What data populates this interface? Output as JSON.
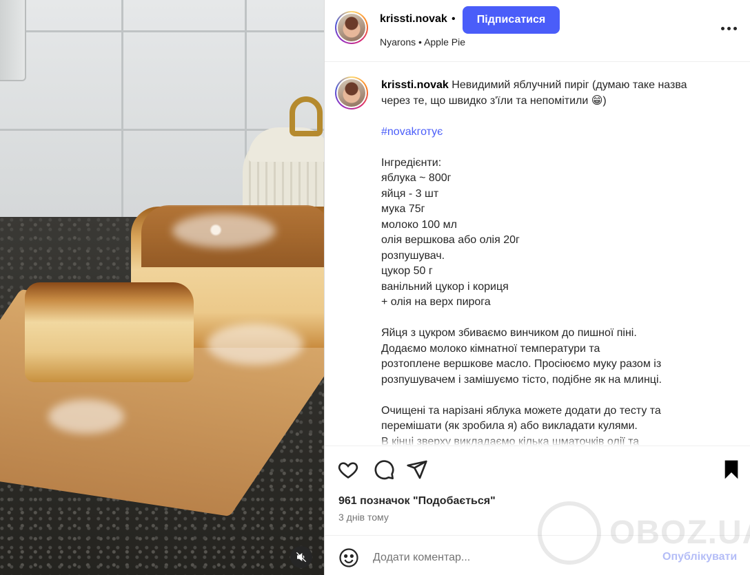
{
  "post": {
    "username": "krissti.novak",
    "separator_dot": "•",
    "follow_label": "Підписатися",
    "subtitle_artist": "Nyarons",
    "subtitle_dot": "•",
    "subtitle_track": "Apple Pie"
  },
  "caption": {
    "username": "krissti.novak",
    "lines": [
      "Невидимий яблучний пиріг (думаю таке назва",
      "через те, що швидко з'їли та непомітили 😁)",
      "",
      "#novakготує",
      "",
      "Інгредієнти:",
      "яблука ~ 800г",
      "яйця - 3 шт",
      "мука 75г",
      "молоко 100 мл",
      "олія вершкова або олія 20г",
      "розпушувач.",
      "цукор 50 г",
      "ванільний цукор і кориця",
      "+ олія на верх пирога",
      "",
      "Яйця з цукром збиваємо винчиком до пишної піні.",
      "Додаємо молоко кімнатної температури та",
      "розтоплене вершкове масло. Просіюємо муку разом із",
      "розпушувачем і замішуємо тісто, подібне як на млинці.",
      "",
      "Очищені та нарізані яблука можете додати до тесту та",
      "перемішати (як зробила я) або викладати кулями.",
      "В кінці зверху викладаємо кілька шматочків олії та"
    ]
  },
  "engagement": {
    "likes_text": "961 позначок \"Подобається\"",
    "time_ago": "3 днів тому"
  },
  "comment": {
    "placeholder": "Додати коментар...",
    "post_label": "Опублікувати"
  },
  "watermark": {
    "text": "OBOZ.UA"
  },
  "icons": {
    "like": "heart-icon",
    "comment": "comment-icon",
    "share": "send-icon",
    "save": "bookmark-icon",
    "more": "more-icon",
    "emoji": "emoji-icon",
    "mute": "muted-speaker-icon"
  },
  "colors": {
    "accent": "#4a5df9",
    "post_disabled": "#b4bdf7",
    "secondary_text": "#737373"
  }
}
